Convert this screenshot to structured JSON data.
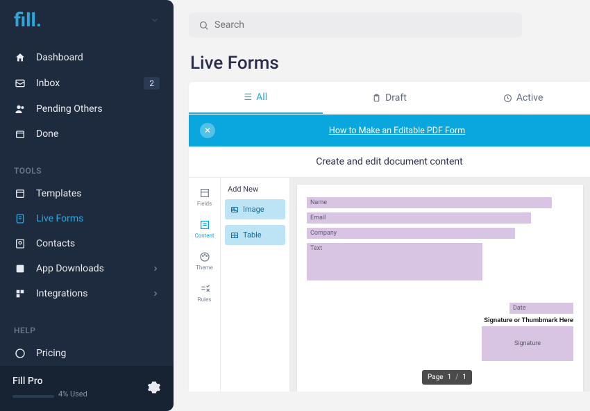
{
  "brand": "fill.",
  "nav": {
    "dashboard": "Dashboard",
    "inbox": "Inbox",
    "inbox_badge": "2",
    "pending": "Pending Others",
    "done": "Done"
  },
  "sections": {
    "tools": "TOOLS",
    "help": "HELP"
  },
  "tools": {
    "templates": "Templates",
    "live_forms": "Live Forms",
    "contacts": "Contacts",
    "app_downloads": "App Downloads",
    "integrations": "Integrations"
  },
  "help": {
    "pricing": "Pricing"
  },
  "footer": {
    "title": "Fill Pro",
    "usage_text": "4% Used",
    "usage_pct": 4
  },
  "search": {
    "placeholder": "Search"
  },
  "page_title": "Live Forms",
  "tabs": {
    "all": "All",
    "draft": "Draft",
    "active": "Active"
  },
  "banner": {
    "text": "How to Make an Editable PDF Form"
  },
  "subheader": "Create and edit document content",
  "toolcol": {
    "fields": "Fields",
    "content": "Content",
    "theme": "Theme",
    "rules": "Rules"
  },
  "panel": {
    "title": "Add New",
    "image": "Image",
    "table": "Table"
  },
  "form_fields": {
    "name": "Name",
    "email": "Email",
    "company": "Company",
    "text": "Text",
    "date": "Date",
    "sig_label": "Signature or Thumbmark Here",
    "signature": "Signature"
  },
  "pager": {
    "label": "Page",
    "current": "1",
    "sep": "/",
    "total": "1"
  }
}
